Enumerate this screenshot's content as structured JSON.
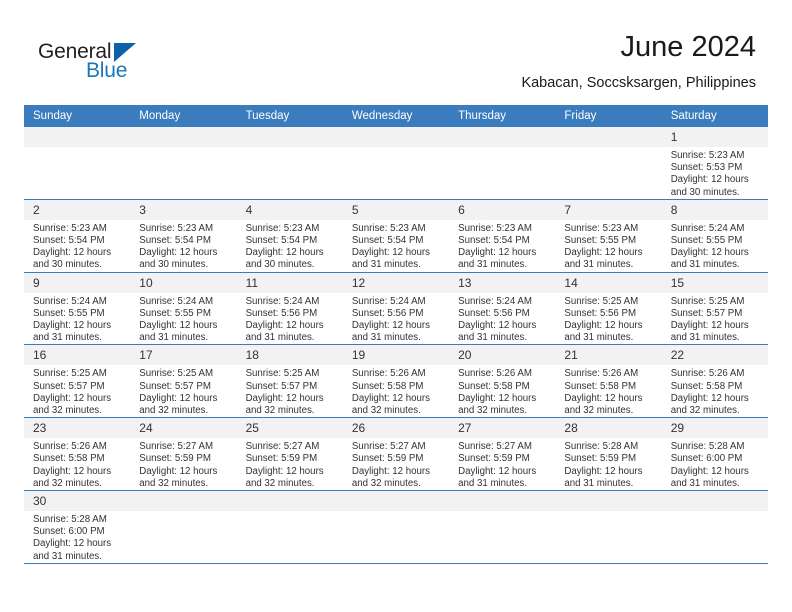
{
  "brand": {
    "word1": "General",
    "word2": "Blue",
    "triangle_color": "#0b62ab",
    "text_color": "#231f20",
    "blue_color": "#1b75bb"
  },
  "header": {
    "title": "June 2024",
    "subtitle": "Kabacan, Soccsksargen, Philippines"
  },
  "theme": {
    "header_bg": "#3a7cbe",
    "header_text": "#ffffff",
    "daynum_bg": "#f2f2f2",
    "cell_text": "#333333",
    "row_border": "#3a7cbe"
  },
  "columns": [
    "Sunday",
    "Monday",
    "Tuesday",
    "Wednesday",
    "Thursday",
    "Friday",
    "Saturday"
  ],
  "weeks": [
    [
      {
        "blank": true
      },
      {
        "blank": true
      },
      {
        "blank": true
      },
      {
        "blank": true
      },
      {
        "blank": true
      },
      {
        "blank": true
      },
      {
        "day": "1",
        "sunrise": "Sunrise: 5:23 AM",
        "sunset": "Sunset: 5:53 PM",
        "daylight1": "Daylight: 12 hours",
        "daylight2": "and 30 minutes."
      }
    ],
    [
      {
        "day": "2",
        "sunrise": "Sunrise: 5:23 AM",
        "sunset": "Sunset: 5:54 PM",
        "daylight1": "Daylight: 12 hours",
        "daylight2": "and 30 minutes."
      },
      {
        "day": "3",
        "sunrise": "Sunrise: 5:23 AM",
        "sunset": "Sunset: 5:54 PM",
        "daylight1": "Daylight: 12 hours",
        "daylight2": "and 30 minutes."
      },
      {
        "day": "4",
        "sunrise": "Sunrise: 5:23 AM",
        "sunset": "Sunset: 5:54 PM",
        "daylight1": "Daylight: 12 hours",
        "daylight2": "and 30 minutes."
      },
      {
        "day": "5",
        "sunrise": "Sunrise: 5:23 AM",
        "sunset": "Sunset: 5:54 PM",
        "daylight1": "Daylight: 12 hours",
        "daylight2": "and 31 minutes."
      },
      {
        "day": "6",
        "sunrise": "Sunrise: 5:23 AM",
        "sunset": "Sunset: 5:54 PM",
        "daylight1": "Daylight: 12 hours",
        "daylight2": "and 31 minutes."
      },
      {
        "day": "7",
        "sunrise": "Sunrise: 5:23 AM",
        "sunset": "Sunset: 5:55 PM",
        "daylight1": "Daylight: 12 hours",
        "daylight2": "and 31 minutes."
      },
      {
        "day": "8",
        "sunrise": "Sunrise: 5:24 AM",
        "sunset": "Sunset: 5:55 PM",
        "daylight1": "Daylight: 12 hours",
        "daylight2": "and 31 minutes."
      }
    ],
    [
      {
        "day": "9",
        "sunrise": "Sunrise: 5:24 AM",
        "sunset": "Sunset: 5:55 PM",
        "daylight1": "Daylight: 12 hours",
        "daylight2": "and 31 minutes."
      },
      {
        "day": "10",
        "sunrise": "Sunrise: 5:24 AM",
        "sunset": "Sunset: 5:55 PM",
        "daylight1": "Daylight: 12 hours",
        "daylight2": "and 31 minutes."
      },
      {
        "day": "11",
        "sunrise": "Sunrise: 5:24 AM",
        "sunset": "Sunset: 5:56 PM",
        "daylight1": "Daylight: 12 hours",
        "daylight2": "and 31 minutes."
      },
      {
        "day": "12",
        "sunrise": "Sunrise: 5:24 AM",
        "sunset": "Sunset: 5:56 PM",
        "daylight1": "Daylight: 12 hours",
        "daylight2": "and 31 minutes."
      },
      {
        "day": "13",
        "sunrise": "Sunrise: 5:24 AM",
        "sunset": "Sunset: 5:56 PM",
        "daylight1": "Daylight: 12 hours",
        "daylight2": "and 31 minutes."
      },
      {
        "day": "14",
        "sunrise": "Sunrise: 5:25 AM",
        "sunset": "Sunset: 5:56 PM",
        "daylight1": "Daylight: 12 hours",
        "daylight2": "and 31 minutes."
      },
      {
        "day": "15",
        "sunrise": "Sunrise: 5:25 AM",
        "sunset": "Sunset: 5:57 PM",
        "daylight1": "Daylight: 12 hours",
        "daylight2": "and 31 minutes."
      }
    ],
    [
      {
        "day": "16",
        "sunrise": "Sunrise: 5:25 AM",
        "sunset": "Sunset: 5:57 PM",
        "daylight1": "Daylight: 12 hours",
        "daylight2": "and 32 minutes."
      },
      {
        "day": "17",
        "sunrise": "Sunrise: 5:25 AM",
        "sunset": "Sunset: 5:57 PM",
        "daylight1": "Daylight: 12 hours",
        "daylight2": "and 32 minutes."
      },
      {
        "day": "18",
        "sunrise": "Sunrise: 5:25 AM",
        "sunset": "Sunset: 5:57 PM",
        "daylight1": "Daylight: 12 hours",
        "daylight2": "and 32 minutes."
      },
      {
        "day": "19",
        "sunrise": "Sunrise: 5:26 AM",
        "sunset": "Sunset: 5:58 PM",
        "daylight1": "Daylight: 12 hours",
        "daylight2": "and 32 minutes."
      },
      {
        "day": "20",
        "sunrise": "Sunrise: 5:26 AM",
        "sunset": "Sunset: 5:58 PM",
        "daylight1": "Daylight: 12 hours",
        "daylight2": "and 32 minutes."
      },
      {
        "day": "21",
        "sunrise": "Sunrise: 5:26 AM",
        "sunset": "Sunset: 5:58 PM",
        "daylight1": "Daylight: 12 hours",
        "daylight2": "and 32 minutes."
      },
      {
        "day": "22",
        "sunrise": "Sunrise: 5:26 AM",
        "sunset": "Sunset: 5:58 PM",
        "daylight1": "Daylight: 12 hours",
        "daylight2": "and 32 minutes."
      }
    ],
    [
      {
        "day": "23",
        "sunrise": "Sunrise: 5:26 AM",
        "sunset": "Sunset: 5:58 PM",
        "daylight1": "Daylight: 12 hours",
        "daylight2": "and 32 minutes."
      },
      {
        "day": "24",
        "sunrise": "Sunrise: 5:27 AM",
        "sunset": "Sunset: 5:59 PM",
        "daylight1": "Daylight: 12 hours",
        "daylight2": "and 32 minutes."
      },
      {
        "day": "25",
        "sunrise": "Sunrise: 5:27 AM",
        "sunset": "Sunset: 5:59 PM",
        "daylight1": "Daylight: 12 hours",
        "daylight2": "and 32 minutes."
      },
      {
        "day": "26",
        "sunrise": "Sunrise: 5:27 AM",
        "sunset": "Sunset: 5:59 PM",
        "daylight1": "Daylight: 12 hours",
        "daylight2": "and 32 minutes."
      },
      {
        "day": "27",
        "sunrise": "Sunrise: 5:27 AM",
        "sunset": "Sunset: 5:59 PM",
        "daylight1": "Daylight: 12 hours",
        "daylight2": "and 31 minutes."
      },
      {
        "day": "28",
        "sunrise": "Sunrise: 5:28 AM",
        "sunset": "Sunset: 5:59 PM",
        "daylight1": "Daylight: 12 hours",
        "daylight2": "and 31 minutes."
      },
      {
        "day": "29",
        "sunrise": "Sunrise: 5:28 AM",
        "sunset": "Sunset: 6:00 PM",
        "daylight1": "Daylight: 12 hours",
        "daylight2": "and 31 minutes."
      }
    ],
    [
      {
        "day": "30",
        "sunrise": "Sunrise: 5:28 AM",
        "sunset": "Sunset: 6:00 PM",
        "daylight1": "Daylight: 12 hours",
        "daylight2": "and 31 minutes."
      },
      {
        "blank": true
      },
      {
        "blank": true
      },
      {
        "blank": true
      },
      {
        "blank": true
      },
      {
        "blank": true
      },
      {
        "blank": true
      }
    ]
  ]
}
